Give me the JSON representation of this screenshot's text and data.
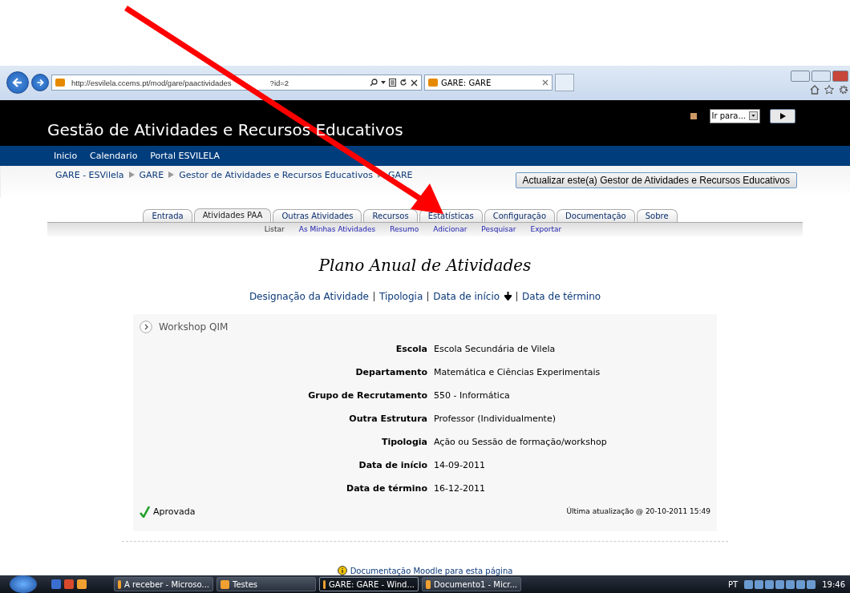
{
  "browser": {
    "url": "http://esvilela.ccems.pt/mod/gare/paactividades",
    "url_tail": "?id=2",
    "tab_title": "GARE: GARE"
  },
  "header": {
    "title": "Gestão de Atividades e Recursos Educativos",
    "jump_select": "Ir para..."
  },
  "nav": [
    "Inicio",
    "Calendario",
    "Portal ESVILELA"
  ],
  "breadcrumb": [
    "GARE - ESVilela",
    "GARE",
    "Gestor de Atividades e Recursos Educativos",
    "GARE"
  ],
  "update_button": "Actualizar este(a) Gestor de Atividades e Recursos Educativos",
  "tabs": [
    {
      "label": "Entrada",
      "selected": false
    },
    {
      "label": "Atividades PAA",
      "selected": true
    },
    {
      "label": "Outras Atividades",
      "selected": false
    },
    {
      "label": "Recursos",
      "selected": false
    },
    {
      "label": "Estatísticas",
      "selected": false
    },
    {
      "label": "Configuração",
      "selected": false
    },
    {
      "label": "Documentação",
      "selected": false
    },
    {
      "label": "Sobre",
      "selected": false
    }
  ],
  "subtabs": [
    {
      "label": "Listar",
      "selected": true
    },
    {
      "label": "As Minhas Atividades",
      "selected": false
    },
    {
      "label": "Resumo",
      "selected": false
    },
    {
      "label": "Adicionar",
      "selected": false
    },
    {
      "label": "Pesquisar",
      "selected": false
    },
    {
      "label": "Exportar",
      "selected": false
    }
  ],
  "page_title": "Plano Anual de Atividades",
  "sort_links": [
    {
      "label": "Designação da Atividade",
      "sorted": false
    },
    {
      "label": "Tipologia",
      "sorted": false
    },
    {
      "label": "Data de início",
      "sorted": true
    },
    {
      "label": "Data de término",
      "sorted": false
    }
  ],
  "activity": {
    "title": "Workshop QIM",
    "fields": [
      {
        "label": "Escola",
        "value": "Escola Secundária de Vilela"
      },
      {
        "label": "Departamento",
        "value": "Matemática e Ciências Experimentais"
      },
      {
        "label": "Grupo de Recrutamento",
        "value": "550 - Informática"
      },
      {
        "label": "Outra Estrutura",
        "value": "Professor (Individualmente)"
      },
      {
        "label": "Tipologia",
        "value": "Ação ou Sessão de formação/workshop"
      },
      {
        "label": "Data de início",
        "value": "14-09-2011"
      },
      {
        "label": "Data de término",
        "value": "16-12-2011"
      }
    ],
    "status": "Aprovada",
    "approved": true,
    "updated": "Última atualização @ 20-10-2011 15:49"
  },
  "footer_link": "Documentação Moodle para esta página",
  "taskbar": {
    "tasks": [
      {
        "label": "A receber - Microso...",
        "selected": false
      },
      {
        "label": "Testes",
        "selected": false
      },
      {
        "label": "GARE: GARE - Wind...",
        "selected": true
      },
      {
        "label": "Documento1 - Micr...",
        "selected": false
      }
    ],
    "language": "PT",
    "time": "19:46"
  }
}
